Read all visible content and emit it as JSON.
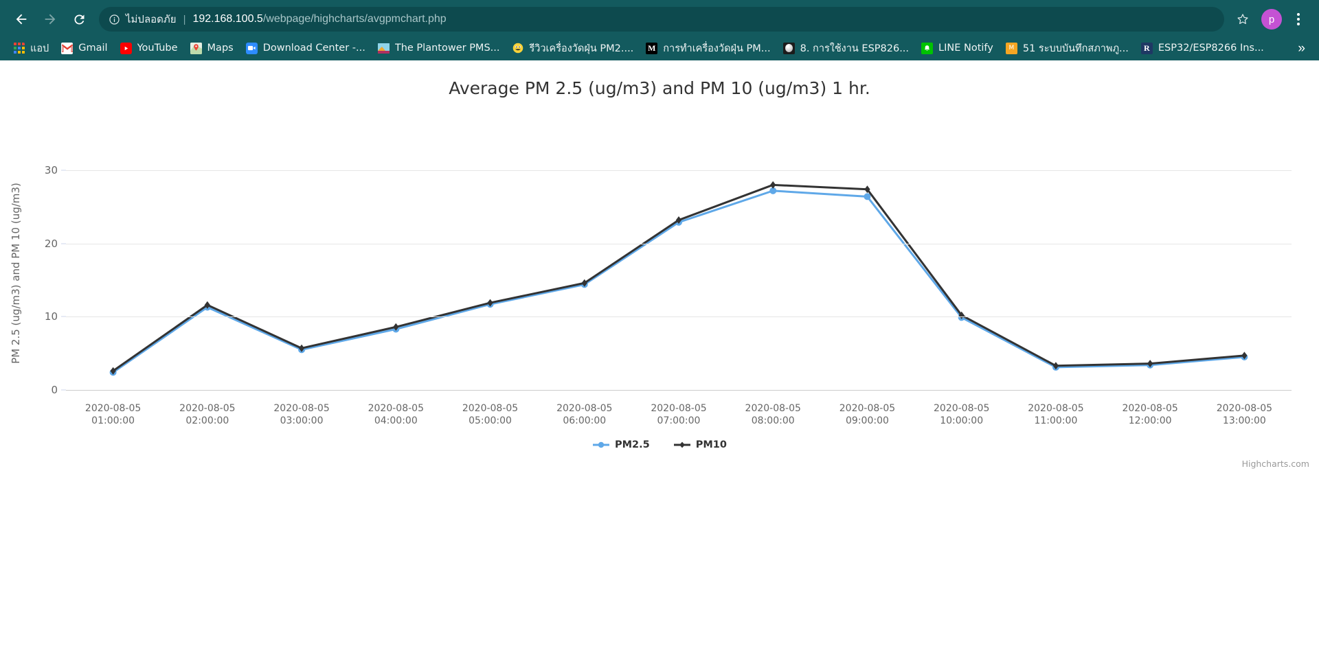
{
  "browser": {
    "back_label": "Back",
    "forward_label": "Forward",
    "reload_label": "Reload",
    "security_label": "ไม่ปลอดภัย",
    "url_host": "192.168.100.5",
    "url_path": "/webpage/highcharts/avgpmchart.php",
    "bookmark_label": "Bookmark this page",
    "profile_initial": "p",
    "menu_label": "Customize and control Google Chrome",
    "overflow_label": "»",
    "chrome_color": "#135a5e",
    "omnibox_color": "#0d4a4e",
    "avatar_color": "#c452d4"
  },
  "bookmarks": [
    {
      "label": "แอป",
      "icon": "apps-grid-icon"
    },
    {
      "label": "Gmail",
      "icon": "gmail-icon"
    },
    {
      "label": "YouTube",
      "icon": "youtube-icon"
    },
    {
      "label": "Maps",
      "icon": "maps-icon"
    },
    {
      "label": "Download Center -...",
      "icon": "download-center-icon"
    },
    {
      "label": "The Plantower PMS...",
      "icon": "plantower-icon"
    },
    {
      "label": "รีวิวเครื่องวัดฝุ่น PM2....",
      "icon": "emoji-icon"
    },
    {
      "label": "การทำเครื่องวัดฝุ่น PM...",
      "icon": "medium-icon"
    },
    {
      "label": "8. การใช้งาน ESP826...",
      "icon": "esp-icon"
    },
    {
      "label": "LINE Notify",
      "icon": "line-notify-icon"
    },
    {
      "label": "51 ระบบบันทึกสภาพภู...",
      "icon": "weather-log-icon"
    },
    {
      "label": "ESP32/ESP8266 Ins...",
      "icon": "randomnerd-icon"
    }
  ],
  "chart_data": {
    "type": "line",
    "title": "Average PM 2.5 (ug/m3) and PM 10 (ug/m3) 1 hr.",
    "xlabel": "",
    "ylabel": "PM 2.5 (ug/m3) and PM 10 (ug/m3)",
    "ylim": [
      0,
      30
    ],
    "yticks": [
      0,
      10,
      20,
      30
    ],
    "grid": true,
    "legend_position": "bottom",
    "credits": "Highcharts.com",
    "categories": [
      "2020-08-05 01:00:00",
      "2020-08-05 02:00:00",
      "2020-08-05 03:00:00",
      "2020-08-05 04:00:00",
      "2020-08-05 05:00:00",
      "2020-08-05 06:00:00",
      "2020-08-05 07:00:00",
      "2020-08-05 08:00:00",
      "2020-08-05 09:00:00",
      "2020-08-05 10:00:00",
      "2020-08-05 11:00:00",
      "2020-08-05 12:00:00",
      "2020-08-05 13:00:00"
    ],
    "category_dates": [
      "2020-08-05",
      "2020-08-05",
      "2020-08-05",
      "2020-08-05",
      "2020-08-05",
      "2020-08-05",
      "2020-08-05",
      "2020-08-05",
      "2020-08-05",
      "2020-08-05",
      "2020-08-05",
      "2020-08-05",
      "2020-08-05"
    ],
    "category_times": [
      "01:00:00",
      "02:00:00",
      "03:00:00",
      "04:00:00",
      "05:00:00",
      "06:00:00",
      "07:00:00",
      "08:00:00",
      "09:00:00",
      "10:00:00",
      "11:00:00",
      "12:00:00",
      "13:00:00"
    ],
    "series": [
      {
        "name": "PM2.5",
        "color": "#5fa8e8",
        "marker": "circle",
        "values": [
          2.4,
          11.3,
          5.5,
          8.3,
          11.7,
          14.4,
          22.9,
          27.2,
          26.4,
          9.9,
          3.1,
          3.4,
          4.5
        ]
      },
      {
        "name": "PM10",
        "color": "#333333",
        "marker": "diamond",
        "values": [
          2.6,
          11.6,
          5.7,
          8.6,
          11.9,
          14.6,
          23.2,
          28.0,
          27.4,
          10.2,
          3.3,
          3.6,
          4.7
        ]
      }
    ]
  }
}
